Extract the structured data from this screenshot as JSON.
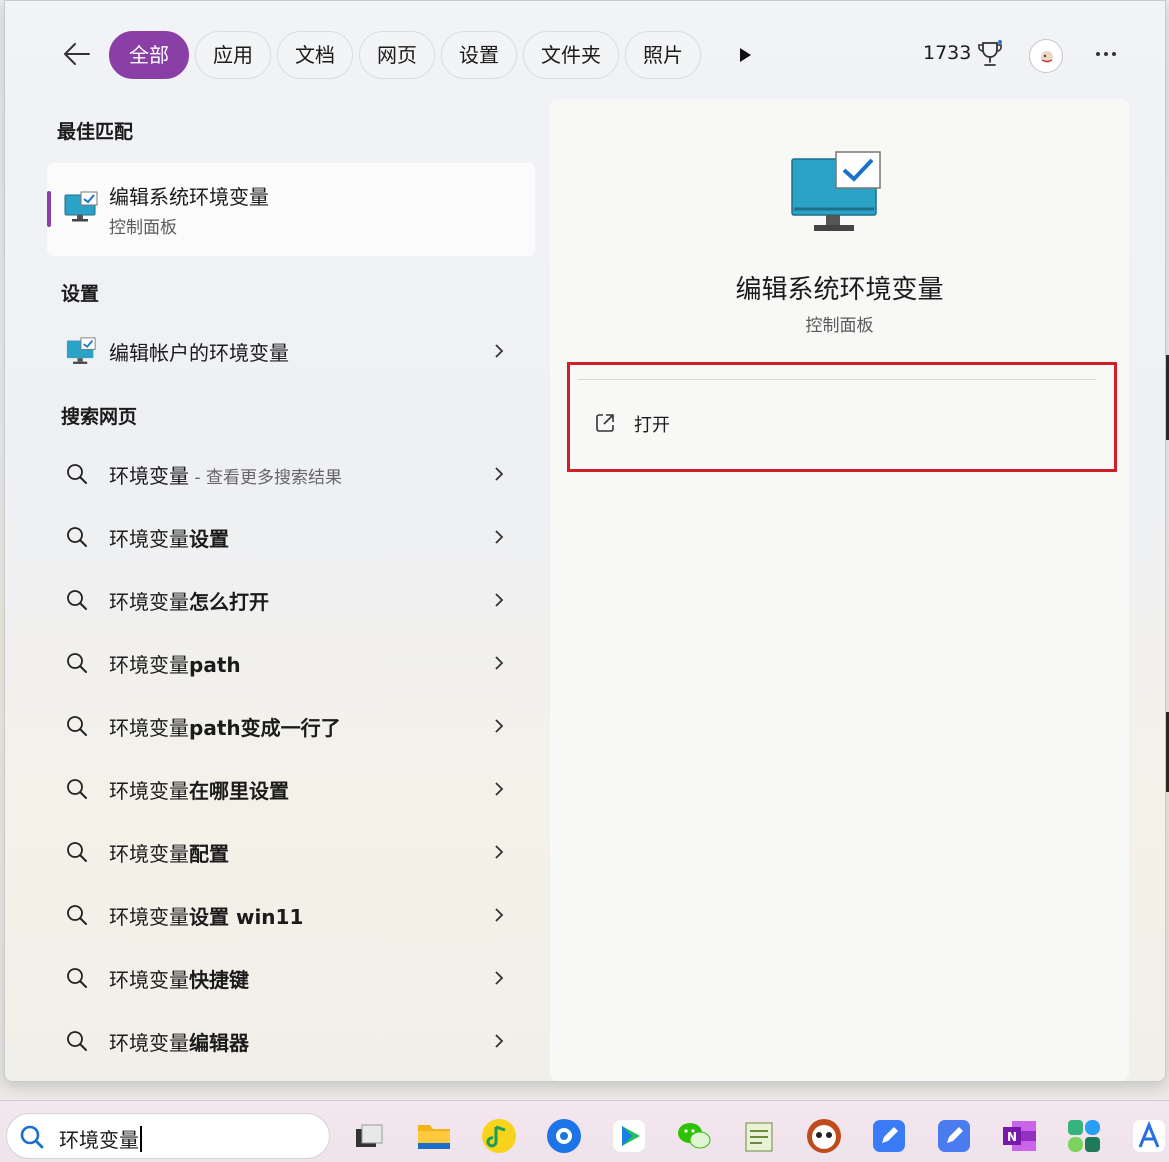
{
  "top_bar": {
    "tabs": [
      "全部",
      "应用",
      "文档",
      "网页",
      "设置",
      "文件夹",
      "照片"
    ],
    "active_tab": "全部",
    "points": "1733"
  },
  "best_match": {
    "heading": "最佳匹配",
    "title": "编辑系统环境变量",
    "subtitle": "控制面板"
  },
  "settings_section": {
    "heading": "设置",
    "items": [
      {
        "label": "编辑帐户的环境变量"
      }
    ]
  },
  "web_section": {
    "heading": "搜索网页",
    "items": [
      {
        "prefix": "环境变量",
        "bold": "",
        "extra": " - 查看更多搜索结果"
      },
      {
        "prefix": "环境变量",
        "bold": "设置",
        "extra": ""
      },
      {
        "prefix": "环境变量",
        "bold": "怎么打开",
        "extra": ""
      },
      {
        "prefix": "环境变量",
        "bold": "path",
        "extra": ""
      },
      {
        "prefix": "环境变量",
        "bold": "path变成一行了",
        "extra": ""
      },
      {
        "prefix": "环境变量",
        "bold": "在哪里设置",
        "extra": ""
      },
      {
        "prefix": "环境变量",
        "bold": "配置",
        "extra": ""
      },
      {
        "prefix": "环境变量",
        "bold": "设置 win11",
        "extra": ""
      },
      {
        "prefix": "环境变量",
        "bold": "快捷键",
        "extra": ""
      },
      {
        "prefix": "环境变量",
        "bold": "编辑器",
        "extra": ""
      }
    ]
  },
  "preview": {
    "title": "编辑系统环境变量",
    "subtitle": "控制面板",
    "action_label": "打开"
  },
  "taskbar": {
    "search_value": "环境变量",
    "apps": [
      "task-view-icon",
      "file-explorer-icon",
      "music-app-icon",
      "browser-app-icon",
      "video-player-icon",
      "wechat-icon",
      "notepad-icon",
      "panda-app-icon",
      "notes-app-icon",
      "notes-app-2-icon",
      "onenote-icon",
      "grid-app-icon",
      "translate-app-icon"
    ]
  },
  "colors": {
    "accent": "#8a3fa6",
    "highlight_border": "#d11f2a"
  }
}
